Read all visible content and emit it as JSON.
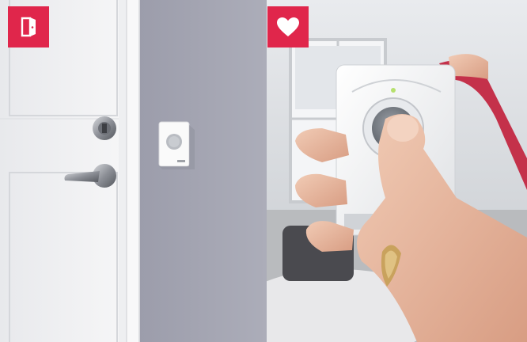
{
  "left_panel": {
    "badge_icon": "door-icon",
    "scene": "door-with-wireless-doorbell-button"
  },
  "right_panel": {
    "badge_icon": "heart-icon",
    "scene": "hand-holding-doorbell-receiver"
  },
  "colors": {
    "badge": "#e0264b",
    "wall_gray": "#a7a8b4",
    "door_white": "#f4f4f5"
  }
}
